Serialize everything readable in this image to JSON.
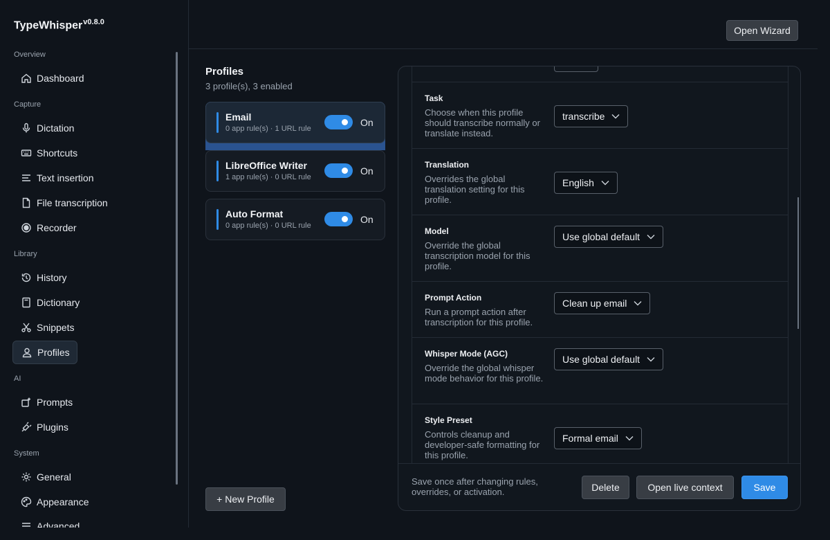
{
  "app": {
    "name": "TypeWhisper",
    "version": "v0.8.0"
  },
  "sidebar": {
    "sections": [
      {
        "label": "Overview",
        "items": [
          {
            "label": "Dashboard",
            "icon": "home-icon"
          }
        ]
      },
      {
        "label": "Capture",
        "items": [
          {
            "label": "Dictation",
            "icon": "microphone-icon"
          },
          {
            "label": "Shortcuts",
            "icon": "keyboard-icon"
          },
          {
            "label": "Text insertion",
            "icon": "text-lines-icon"
          },
          {
            "label": "File transcription",
            "icon": "file-icon"
          },
          {
            "label": "Recorder",
            "icon": "record-icon"
          }
        ]
      },
      {
        "label": "Library",
        "items": [
          {
            "label": "History",
            "icon": "history-icon"
          },
          {
            "label": "Dictionary",
            "icon": "book-icon"
          },
          {
            "label": "Snippets",
            "icon": "scissors-icon"
          },
          {
            "label": "Profiles",
            "icon": "user-icon",
            "active": true
          }
        ]
      },
      {
        "label": "AI",
        "items": [
          {
            "label": "Prompts",
            "icon": "sparkle-icon"
          },
          {
            "label": "Plugins",
            "icon": "plug-icon"
          }
        ]
      },
      {
        "label": "System",
        "items": [
          {
            "label": "General",
            "icon": "gear-icon"
          },
          {
            "label": "Appearance",
            "icon": "palette-icon"
          },
          {
            "label": "Advanced",
            "icon": "sliders-icon"
          }
        ]
      }
    ]
  },
  "topbar": {
    "open_wizard": "Open Wizard"
  },
  "profiles": {
    "title": "Profiles",
    "summary": "3 profile(s), 3 enabled",
    "items": [
      {
        "name": "Email",
        "meta": "0 app rule(s) · 1 URL rule",
        "state": "On",
        "enabled": true
      },
      {
        "name": "LibreOffice Writer",
        "meta": "1 app rule(s) · 0 URL rule",
        "state": "On",
        "enabled": true
      },
      {
        "name": "Auto Format",
        "meta": "0 app rule(s) · 0 URL rule",
        "state": "On",
        "enabled": true
      }
    ],
    "new_button": "+ New Profile"
  },
  "settings": {
    "rows": [
      {
        "label": "Task",
        "desc": "Choose when this profile should transcribe normally or translate instead.",
        "value": "transcribe"
      },
      {
        "label": "Translation",
        "desc": "Overrides the global translation setting for this profile.",
        "value": "English"
      },
      {
        "label": "Model",
        "desc": "Override the global transcription model for this profile.",
        "value": "Use global default"
      },
      {
        "label": "Prompt Action",
        "desc": "Run a prompt action after transcription for this profile.",
        "value": "Clean up email"
      },
      {
        "label": "Whisper Mode (AGC)",
        "desc": "Override the global whisper mode behavior for this profile.",
        "value": "Use global default"
      },
      {
        "label": "Style Preset",
        "desc": "Controls cleanup and developer-safe formatting for this profile.",
        "value": "Formal email"
      }
    ],
    "footer_text": "Save once after changing rules, overrides, or activation.",
    "delete": "Delete",
    "open_live_context": "Open live context",
    "save": "Save"
  },
  "colors": {
    "accent": "#2f8be6",
    "background": "#0f141b",
    "selected_profile": "#2a5390"
  }
}
